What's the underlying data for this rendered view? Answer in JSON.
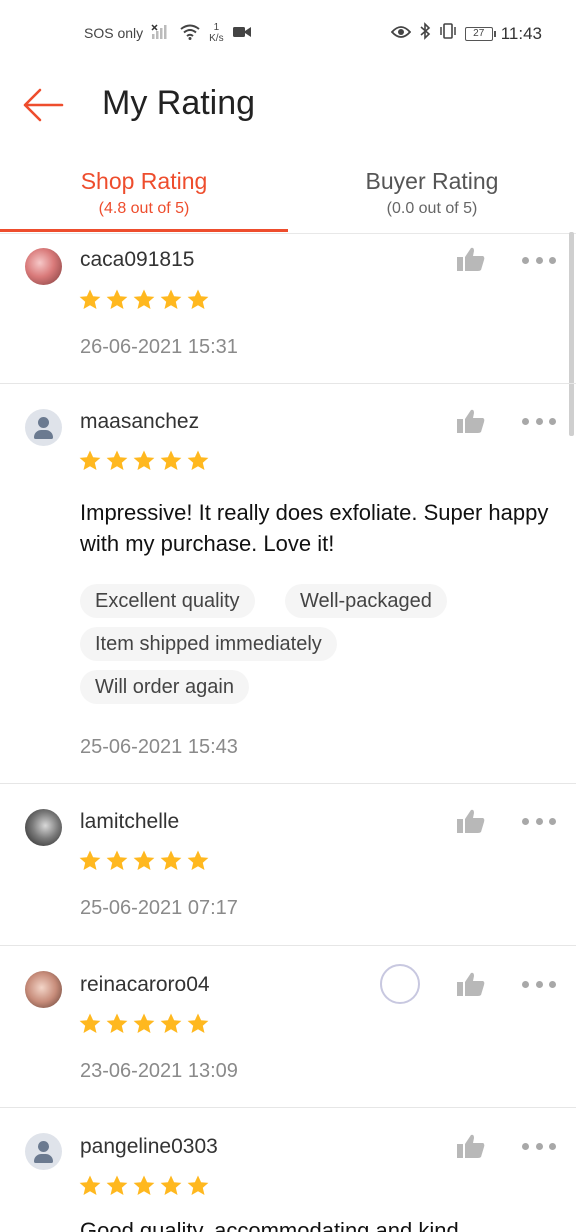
{
  "status_bar": {
    "carrier": "SOS only",
    "speed_value": "1",
    "speed_unit": "K/s",
    "battery": "27",
    "time": "11:43"
  },
  "header": {
    "title": "My Rating"
  },
  "tabs": [
    {
      "label": "Shop Rating",
      "sub": "(4.8 out of 5)",
      "active": true
    },
    {
      "label": "Buyer Rating",
      "sub": "(0.0 out of 5)",
      "active": false
    }
  ],
  "colors": {
    "accent": "#ee4d2d",
    "star": "#ffb81f"
  },
  "reviews": [
    {
      "username": "caca091815",
      "rating": 5,
      "comment": "",
      "tags": [],
      "date": "26-06-2021 15:31",
      "avatar": "photo"
    },
    {
      "username": "maasanchez",
      "rating": 5,
      "comment": "Impressive! It really does exfoliate. Super happy with my purchase. Love it!",
      "tags": [
        "Excellent quality",
        "Well-packaged",
        "Item shipped immediately",
        "Will order again"
      ],
      "date": "25-06-2021 15:43",
      "avatar": "default"
    },
    {
      "username": "lamitchelle",
      "rating": 5,
      "comment": "",
      "tags": [],
      "date": "25-06-2021 07:17",
      "avatar": "photo"
    },
    {
      "username": "reinacaroro04",
      "rating": 5,
      "comment": "",
      "tags": [],
      "date": "23-06-2021 13:09",
      "avatar": "photo"
    },
    {
      "username": "pangeline0303",
      "rating": 5,
      "comment": "Good quality, accommodating and kind",
      "tags": [],
      "date": "",
      "avatar": "default"
    }
  ]
}
